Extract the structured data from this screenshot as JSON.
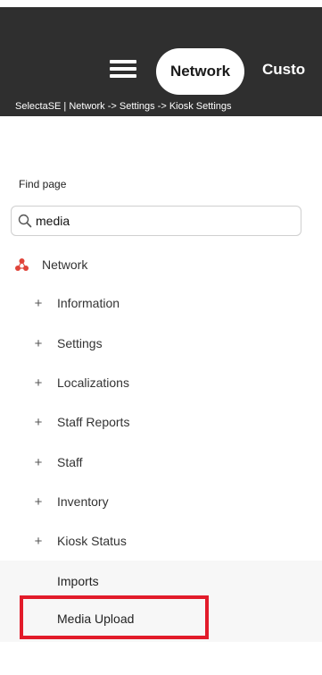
{
  "header": {
    "active_nav": "Network",
    "next_nav": "Custo",
    "breadcrumb": "SelectaSE | Network -> Settings -> Kiosk Settings"
  },
  "sidebar": {
    "find_label": "Find page",
    "search": {
      "value": "media"
    },
    "root": {
      "label": "Network",
      "icon": "network-icon",
      "icon_color": "#e0443a"
    },
    "items": [
      {
        "label": "Information"
      },
      {
        "label": "Settings"
      },
      {
        "label": "Localizations"
      },
      {
        "label": "Staff Reports"
      },
      {
        "label": "Staff"
      },
      {
        "label": "Inventory"
      },
      {
        "label": "Kiosk Status"
      }
    ],
    "subitems": [
      {
        "label": "Imports"
      },
      {
        "label": "Media Upload"
      }
    ]
  },
  "colors": {
    "header_bg": "#2f2f2f",
    "highlight": "#e21b2a"
  }
}
